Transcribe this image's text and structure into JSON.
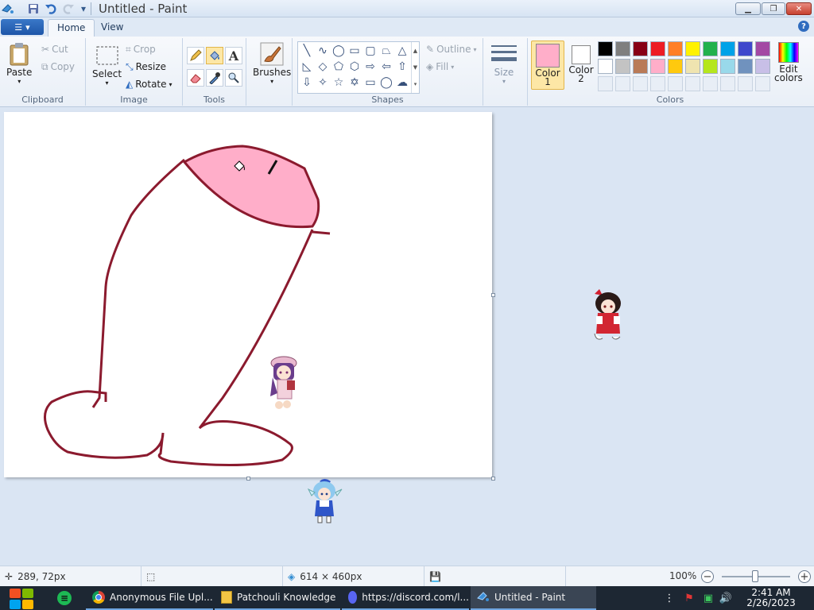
{
  "titlebar": {
    "title": "Untitled - Paint",
    "quick_access": [
      "paint-app-icon",
      "save-icon",
      "undo-icon",
      "redo-icon",
      "customize-dropdown-icon"
    ],
    "buttons": [
      "minimize-icon",
      "restore-icon",
      "close-icon"
    ]
  },
  "tabs": {
    "home": "Home",
    "view": "View"
  },
  "ribbon": {
    "clipboard": {
      "label": "Clipboard",
      "paste": "Paste",
      "cut": "Cut",
      "copy": "Copy"
    },
    "image": {
      "label": "Image",
      "select": "Select",
      "crop": "Crop",
      "resize": "Resize",
      "rotate": "Rotate"
    },
    "tools": {
      "label": "Tools",
      "active_tool": "fill-bucket-icon"
    },
    "brushes": {
      "label": "Brushes"
    },
    "shapes": {
      "label": "Shapes",
      "outline": "Outline",
      "fill": "Fill"
    },
    "size": {
      "label": "Size"
    },
    "colors": {
      "label": "Colors",
      "color1_label_a": "Color",
      "color1_label_b": "1",
      "color2_label_a": "Color",
      "color2_label_b": "2",
      "color1_value": "#ffaec9",
      "color2_value": "#ffffff",
      "edit_colors_a": "Edit",
      "edit_colors_b": "colors",
      "palette_row1": [
        "#000000",
        "#7f7f7f",
        "#880015",
        "#ed1c24",
        "#ff7f27",
        "#fff200",
        "#22b14c",
        "#00a2e8",
        "#3f48cc",
        "#a349a4"
      ],
      "palette_row2": [
        "#ffffff",
        "#c3c3c3",
        "#b97a57",
        "#ffaec9",
        "#ffc90e",
        "#efe4b0",
        "#b5e61d",
        "#99d9ea",
        "#7092be",
        "#c8bfe7"
      ]
    }
  },
  "canvas": {
    "stroke_color": "#8b1a2e",
    "fill_color": "#ffaec9"
  },
  "statusbar": {
    "cursor_pos": "289, 72px",
    "canvas_size": "614 × 460px",
    "zoom": "100%"
  },
  "taskbar": {
    "items": [
      {
        "label": "Anonymous File Upl...",
        "icon": "chrome-icon"
      },
      {
        "label": "Patchouli Knowledge",
        "icon": "folder-icon"
      },
      {
        "label": "https://discord.com/l...",
        "icon": "discord-icon"
      },
      {
        "label": "Untitled - Paint",
        "icon": "paint-app-icon"
      }
    ],
    "time": "2:41 AM",
    "date": "2/26/2023"
  }
}
